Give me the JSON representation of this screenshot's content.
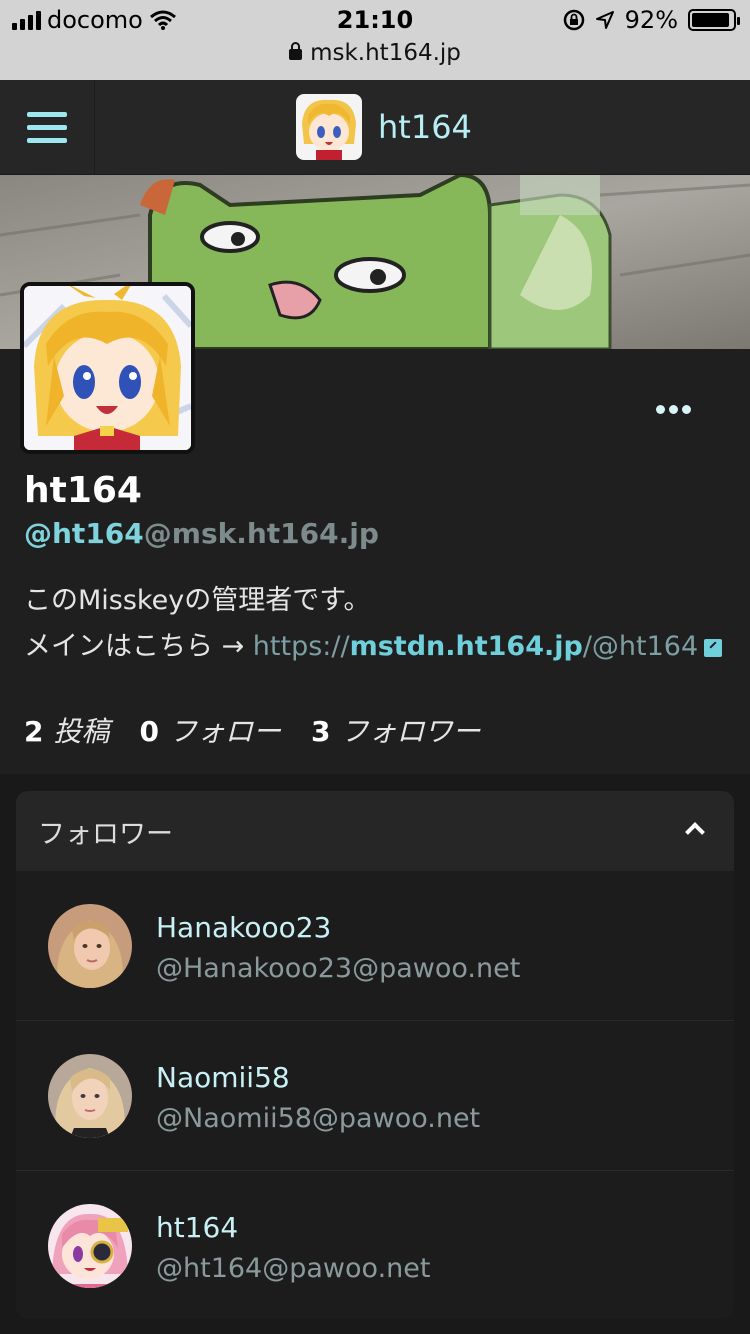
{
  "status_bar": {
    "carrier": "docomo",
    "time": "21:10",
    "battery": "92%",
    "battery_level": 0.92
  },
  "url_bar": {
    "url": "msk.ht164.jp"
  },
  "header": {
    "title": "ht164"
  },
  "profile": {
    "name": "ht164",
    "handle_user": "@ht164",
    "handle_host": "@msk.ht164.jp",
    "description_line1": "このMisskeyの管理者です。",
    "description_line2_prefix": "メインはこちら → ",
    "link_scheme": "https://",
    "link_host": "mstdn.ht164.jp",
    "link_path": "/@ht164",
    "stats": [
      {
        "count": "2",
        "label": "投稿"
      },
      {
        "count": "0",
        "label": "フォロー"
      },
      {
        "count": "3",
        "label": "フォロワー"
      }
    ]
  },
  "followers": {
    "title": "フォロワー",
    "items": [
      {
        "name": "Hanakooo23",
        "acct": "@Hanakooo23@pawoo.net",
        "avatar": "woman-avatar-blonde"
      },
      {
        "name": "Naomii58",
        "acct": "@Naomii58@pawoo.net",
        "avatar": "woman-avatar-blonde-2"
      },
      {
        "name": "ht164",
        "acct": "@ht164@pawoo.net",
        "avatar": "anime-avatar-pink"
      }
    ]
  },
  "colors": {
    "accent": "#7fd3dc",
    "header_bg": "#262626",
    "page_bg": "#191919"
  }
}
